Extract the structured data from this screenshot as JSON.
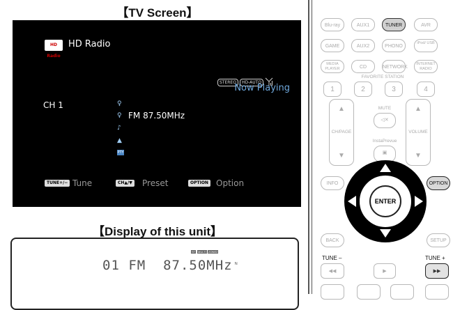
{
  "headings": {
    "tv_screen": "【TV Screen】",
    "unit_display": "【Display of this unit】"
  },
  "tv": {
    "logo_text": "HD Radio",
    "title": "HD Radio",
    "stereo_tag": "STEREO",
    "hdauto_tag": "HD-AUTO",
    "now_playing": "Now Playing",
    "channel": "CH 1",
    "frequency": "FM 87.50MHz",
    "pty_tag": "PTY",
    "guide": [
      {
        "button": "TUNE+/−",
        "label": "Tune"
      },
      {
        "button": "CH▲/▼",
        "label": "Preset"
      },
      {
        "button": "OPTION",
        "label": "Option"
      }
    ]
  },
  "unit_display": {
    "text": "01 FM  87.50MHz",
    "badge_small": "ST",
    "badge_multi": "MULTI",
    "badge_zone": "ZONE2"
  },
  "remote": {
    "row1": [
      "Blu-ray",
      "AUX1",
      "TUNER",
      "AVR"
    ],
    "row2": [
      "GAME",
      "AUX2",
      "PHONO",
      "iPod/ USB"
    ],
    "row3": [
      "MEDIA PLAYER",
      "CD",
      "NETWORK",
      "INTERNET RADIO"
    ],
    "favorite_label": "FAVORITE STATION",
    "favorites": [
      "1",
      "2",
      "3",
      "4"
    ],
    "mute_label": "MUTE",
    "chpage_label": "CH/PAGE",
    "volume_label": "VOLUME",
    "instaprevue_label": "InstaPrevue",
    "info": "INFO",
    "option": "OPTION",
    "enter": "ENTER",
    "back": "BACK",
    "setup": "SETUP",
    "tune_minus": "TUNE –",
    "tune_plus": "TUNE +",
    "active_input": "TUNER",
    "colors": {
      "accent": "#6fa8dc",
      "screen_bg": "#000000",
      "active_btn": "#d0d0d0"
    }
  }
}
